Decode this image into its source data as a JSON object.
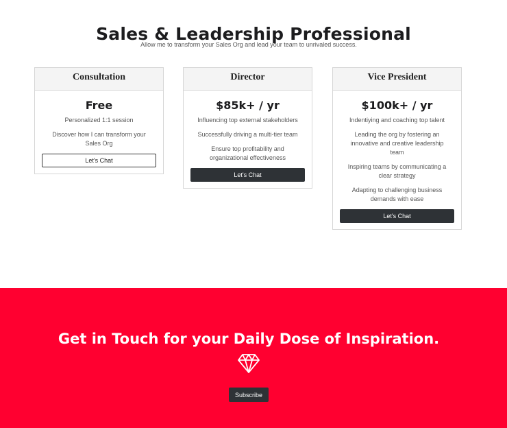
{
  "hero": {
    "title": "Sales & Leadership Professional",
    "subtitle": "Allow me to transform your Sales Org and lead your team to unrivaled success."
  },
  "plans": [
    {
      "name": "Consultation",
      "price": "Free",
      "features": [
        "Personalized 1:1 session",
        "Discover how I can transform your Sales Org"
      ],
      "button_label": "Let's Chat"
    },
    {
      "name": "Director",
      "price": "$85k+ / yr",
      "features": [
        "Influencing top external stakeholders",
        "Successfully driving a multi-tier team",
        "Ensure top profitability and organizational effectiveness"
      ],
      "button_label": "Let's Chat"
    },
    {
      "name": "Vice President",
      "price": "$100k+ / yr",
      "features": [
        "Indentiying and coaching top talent",
        "Leading the org by fostering an innovative and creative leadership team",
        "Inspiring teams by communicating a clear strategy",
        "Adapting to challenging business demands with ease"
      ],
      "button_label": "Let's Chat"
    }
  ],
  "cta": {
    "title": "Get in Touch for your Daily Dose of Inspiration.",
    "icon": "diamond-icon",
    "button_label": "Subscribe"
  },
  "colors": {
    "accent_red": "#ff0030",
    "dark_button": "#2e3236"
  }
}
